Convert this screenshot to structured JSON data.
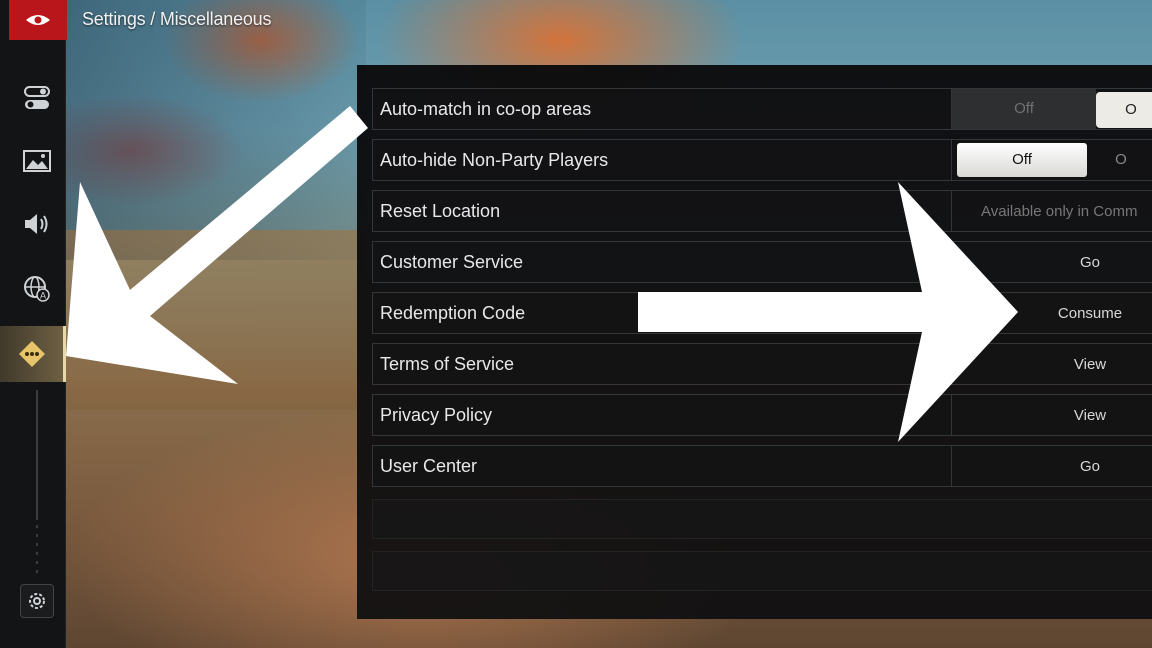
{
  "header": {
    "breadcrumb": "Settings / Miscellaneous"
  },
  "sidebar": {
    "items": [
      {
        "icon": "toggle-settings-icon"
      },
      {
        "icon": "image-icon"
      },
      {
        "icon": "speaker-icon"
      },
      {
        "icon": "globe-language-icon"
      },
      {
        "icon": "diamond-misc-icon",
        "active": true
      }
    ],
    "bottom_icon": "gear-icon",
    "accent": "#b8161a"
  },
  "settings": {
    "rows": [
      {
        "label": "Auto-match in co-op areas",
        "off": "Off",
        "on": "O"
      },
      {
        "label": "Auto-hide Non-Party Players",
        "off": "Off",
        "on": "O"
      },
      {
        "label": "Reset Location",
        "value": "Available only in Comm"
      },
      {
        "label": "Customer Service",
        "action": "Go"
      },
      {
        "label": "Redemption Code",
        "action": "Consume"
      },
      {
        "label": "Terms of Service",
        "action": "View"
      },
      {
        "label": "Privacy Policy",
        "action": "View"
      },
      {
        "label": "User Center",
        "action": "Go"
      }
    ]
  }
}
